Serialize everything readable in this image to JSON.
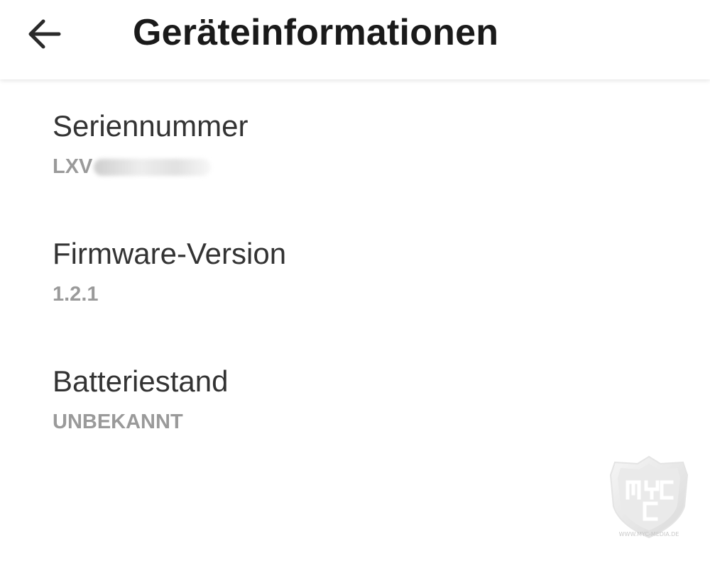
{
  "header": {
    "back_icon": "arrow-left-icon",
    "title": "Geräteinformationen"
  },
  "items": [
    {
      "label": "Seriennummer",
      "value": "LXV",
      "value_redacted": true
    },
    {
      "label": "Firmware-Version",
      "value": "1.2.1"
    },
    {
      "label": "Batteriestand",
      "value": "UNBEKANNT"
    }
  ],
  "watermark": {
    "mark": "MYC",
    "url": "WWW.MYC-MEDIA.DE"
  },
  "colors": {
    "title": "#1a1a1a",
    "label": "#333333",
    "value": "#9a9a9a",
    "background": "#ffffff"
  }
}
